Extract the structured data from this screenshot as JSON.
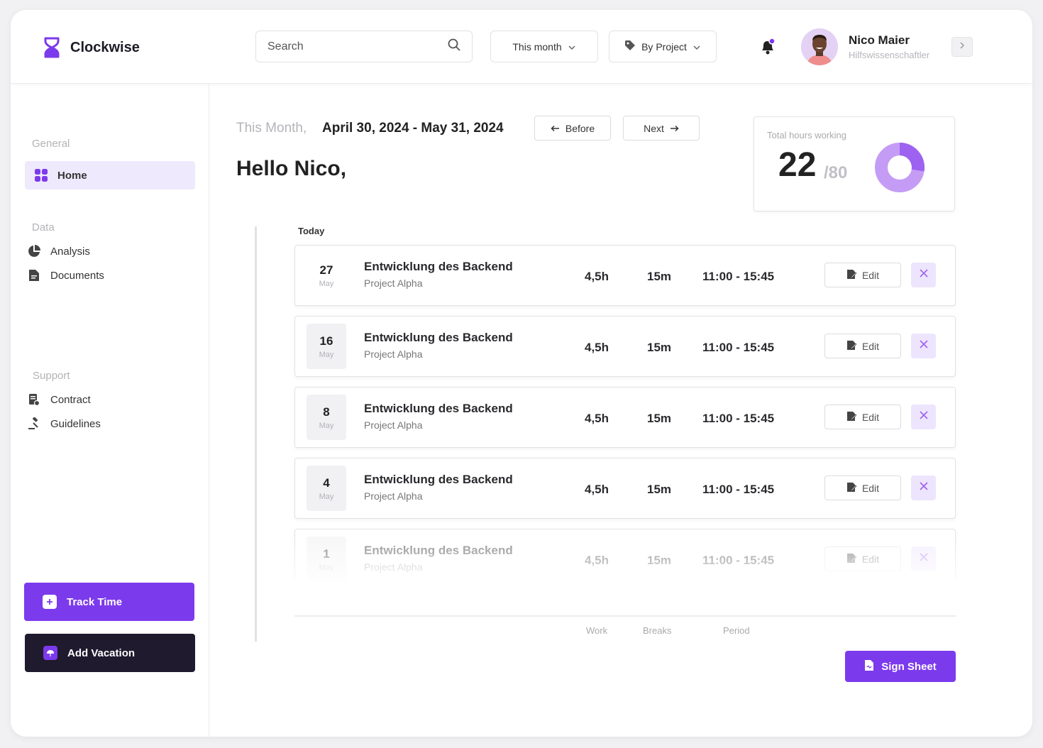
{
  "app": {
    "name": "Clockwise"
  },
  "header": {
    "search_placeholder": "Search",
    "period_filter": "This month",
    "group_filter": "By Project",
    "user": {
      "name": "Nico Maier",
      "role": "Hilfswissenschaftler"
    }
  },
  "sidebar": {
    "general_label": "General",
    "home": "Home",
    "data_label": "Data",
    "analysis": "Analysis",
    "documents": "Documents",
    "support_label": "Support",
    "contract": "Contract",
    "guidelines": "Guidelines",
    "track_time": "Track Time",
    "add_vacation": "Add Vacation"
  },
  "main": {
    "range_prefix": "This Month,",
    "range_value": "April 30, 2024 - May 31, 2024",
    "before_label": "Before",
    "next_label": "Next",
    "greeting": "Hello Nico,",
    "today_label": "Today",
    "hours_card": {
      "label": "Total hours working",
      "value": "22",
      "total": "/80",
      "fraction": 0.275
    },
    "edit_label": "Edit",
    "entries": [
      {
        "day": "27",
        "month": "May",
        "title": "Entwicklung des Backend",
        "project": "Project Alpha",
        "work": "4,5h",
        "breaks": "15m",
        "period": "11:00 - 15:45"
      },
      {
        "day": "16",
        "month": "May",
        "title": "Entwicklung des Backend",
        "project": "Project Alpha",
        "work": "4,5h",
        "breaks": "15m",
        "period": "11:00 - 15:45"
      },
      {
        "day": "8",
        "month": "May",
        "title": "Entwicklung des Backend",
        "project": "Project Alpha",
        "work": "4,5h",
        "breaks": "15m",
        "period": "11:00 - 15:45"
      },
      {
        "day": "4",
        "month": "May",
        "title": "Entwicklung des Backend",
        "project": "Project Alpha",
        "work": "4,5h",
        "breaks": "15m",
        "period": "11:00 - 15:45"
      },
      {
        "day": "1",
        "month": "May",
        "title": "Entwicklung des Backend",
        "project": "Project Alpha",
        "work": "4,5h",
        "breaks": "15m",
        "period": "11:00 - 15:45"
      }
    ],
    "columns": {
      "work": "Work",
      "breaks": "Breaks",
      "period": "Period"
    },
    "sign_sheet": "Sign Sheet"
  },
  "colors": {
    "accent": "#7c3aed",
    "accent_light": "#c59cf5",
    "dark": "#1f1a2e"
  }
}
